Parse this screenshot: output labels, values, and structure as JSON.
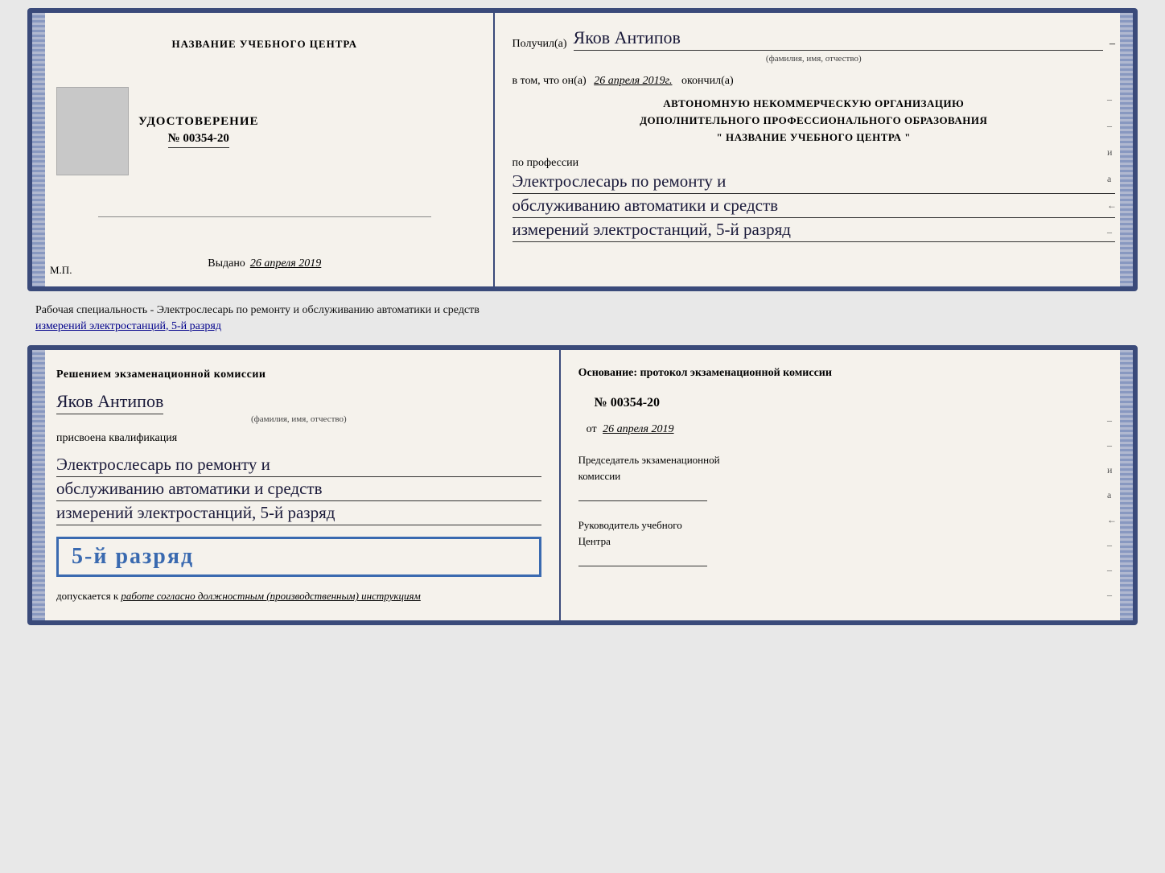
{
  "page": {
    "bg_color": "#e8e8e8"
  },
  "top_booklet": {
    "left": {
      "center_name": "НАЗВАНИЕ УЧЕБНОГО ЦЕНТРА",
      "cert_title": "УДОСТОВЕРЕНИЕ",
      "cert_number": "№ 00354-20",
      "issued_label": "Выдано",
      "issued_date": "26 апреля 2019",
      "mp": "М.П."
    },
    "right": {
      "recipient_label": "Получил(а)",
      "recipient_name": "Яков Антипов",
      "recipient_sub": "(фамилия, имя, отчество)",
      "certifies_prefix": "в том, что он(а)",
      "certifies_date": "26 апреля 2019г.",
      "certifies_suffix": "окончил(а)",
      "org_line1": "АВТОНОМНУЮ НЕКОММЕРЧЕСКУЮ ОРГАНИЗАЦИЮ",
      "org_line2": "ДОПОЛНИТЕЛЬНОГО ПРОФЕССИОНАЛЬНОГО ОБРАЗОВАНИЯ",
      "org_line3": "\"   НАЗВАНИЕ УЧЕБНОГО ЦЕНТРА   \"",
      "profession_label": "по профессии",
      "profession_line1": "Электрослесарь по ремонту и",
      "profession_line2": "обслуживанию автоматики и средств",
      "profession_line3": "измерений электростанций, 5-й разряд",
      "side_marks": [
        "-",
        "-",
        "и",
        "а",
        "←",
        "-"
      ]
    }
  },
  "middle_text": {
    "line1": "Рабочая специальность - Электрослесарь по ремонту и обслуживанию автоматики и средств",
    "line2": "измерений электростанций, 5-й разряд"
  },
  "bottom_booklet": {
    "left": {
      "decision_title": "Решением экзаменационной комиссии",
      "name": "Яков Антипов",
      "name_sub": "(фамилия, имя, отчество)",
      "qualification_label": "присвоена квалификация",
      "qual_line1": "Электрослесарь по ремонту и",
      "qual_line2": "обслуживанию автоматики и средств",
      "qual_line3": "измерений электростанций, 5-й разряд",
      "grade_badge": "5-й разряд",
      "admitted_text": "допускается к",
      "admitted_italic": "работе согласно должностным (производственным) инструкциям"
    },
    "right": {
      "basis_label": "Основание: протокол экзаменационной комиссии",
      "protocol_number": "№ 00354-20",
      "protocol_date_prefix": "от",
      "protocol_date": "26 апреля 2019",
      "chairman_line1": "Председатель экзаменационной",
      "chairman_line2": "комиссии",
      "director_line1": "Руководитель учебного",
      "director_line2": "Центра",
      "side_marks": [
        "-",
        "-",
        "и",
        "а",
        "←",
        "-",
        "-",
        "-"
      ]
    }
  }
}
